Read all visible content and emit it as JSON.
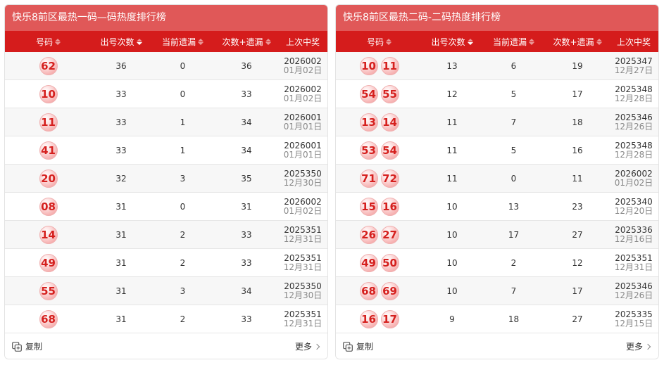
{
  "left": {
    "title": "快乐8前区最热一码—码热度排行榜",
    "headers": [
      "号码",
      "出号次数",
      "当前遗漏",
      "次数+遗漏",
      "上次中奖"
    ],
    "rows": [
      {
        "balls": [
          "62"
        ],
        "count": "36",
        "miss": "0",
        "sum": "36",
        "issue": "2026002",
        "date": "01月02日"
      },
      {
        "balls": [
          "10"
        ],
        "count": "33",
        "miss": "0",
        "sum": "33",
        "issue": "2026002",
        "date": "01月02日"
      },
      {
        "balls": [
          "11"
        ],
        "count": "33",
        "miss": "1",
        "sum": "34",
        "issue": "2026001",
        "date": "01月01日"
      },
      {
        "balls": [
          "41"
        ],
        "count": "33",
        "miss": "1",
        "sum": "34",
        "issue": "2026001",
        "date": "01月01日"
      },
      {
        "balls": [
          "20"
        ],
        "count": "32",
        "miss": "3",
        "sum": "35",
        "issue": "2025350",
        "date": "12月30日"
      },
      {
        "balls": [
          "08"
        ],
        "count": "31",
        "miss": "0",
        "sum": "31",
        "issue": "2026002",
        "date": "01月02日"
      },
      {
        "balls": [
          "14"
        ],
        "count": "31",
        "miss": "2",
        "sum": "33",
        "issue": "2025351",
        "date": "12月31日"
      },
      {
        "balls": [
          "49"
        ],
        "count": "31",
        "miss": "2",
        "sum": "33",
        "issue": "2025351",
        "date": "12月31日"
      },
      {
        "balls": [
          "55"
        ],
        "count": "31",
        "miss": "3",
        "sum": "34",
        "issue": "2025350",
        "date": "12月30日"
      },
      {
        "balls": [
          "68"
        ],
        "count": "31",
        "miss": "2",
        "sum": "33",
        "issue": "2025351",
        "date": "12月31日"
      }
    ],
    "copy_label": "复制",
    "more_label": "更多"
  },
  "right": {
    "title": "快乐8前区最热二码-二码热度排行榜",
    "headers": [
      "号码",
      "出号次数",
      "当前遗漏",
      "次数+遗漏",
      "上次中奖"
    ],
    "rows": [
      {
        "balls": [
          "10",
          "11"
        ],
        "count": "13",
        "miss": "6",
        "sum": "19",
        "issue": "2025347",
        "date": "12月27日"
      },
      {
        "balls": [
          "54",
          "55"
        ],
        "count": "12",
        "miss": "5",
        "sum": "17",
        "issue": "2025348",
        "date": "12月28日"
      },
      {
        "balls": [
          "13",
          "14"
        ],
        "count": "11",
        "miss": "7",
        "sum": "18",
        "issue": "2025346",
        "date": "12月26日"
      },
      {
        "balls": [
          "53",
          "54"
        ],
        "count": "11",
        "miss": "5",
        "sum": "16",
        "issue": "2025348",
        "date": "12月28日"
      },
      {
        "balls": [
          "71",
          "72"
        ],
        "count": "11",
        "miss": "0",
        "sum": "11",
        "issue": "2026002",
        "date": "01月02日"
      },
      {
        "balls": [
          "15",
          "16"
        ],
        "count": "10",
        "miss": "13",
        "sum": "23",
        "issue": "2025340",
        "date": "12月20日"
      },
      {
        "balls": [
          "26",
          "27"
        ],
        "count": "10",
        "miss": "17",
        "sum": "27",
        "issue": "2025336",
        "date": "12月16日"
      },
      {
        "balls": [
          "49",
          "50"
        ],
        "count": "10",
        "miss": "2",
        "sum": "12",
        "issue": "2025351",
        "date": "12月31日"
      },
      {
        "balls": [
          "68",
          "69"
        ],
        "count": "10",
        "miss": "7",
        "sum": "17",
        "issue": "2025346",
        "date": "12月26日"
      },
      {
        "balls": [
          "16",
          "17"
        ],
        "count": "9",
        "miss": "18",
        "sum": "27",
        "issue": "2025335",
        "date": "12月15日"
      }
    ],
    "copy_label": "复制",
    "more_label": "更多"
  },
  "colors": {
    "title_bg": "#e05858",
    "header_bg": "#d51c1c",
    "ball_text": "#d5201e"
  },
  "icons": {
    "sort": "sort-updown-icon",
    "copy": "copy-icon",
    "more": "chevron-right-icon"
  }
}
